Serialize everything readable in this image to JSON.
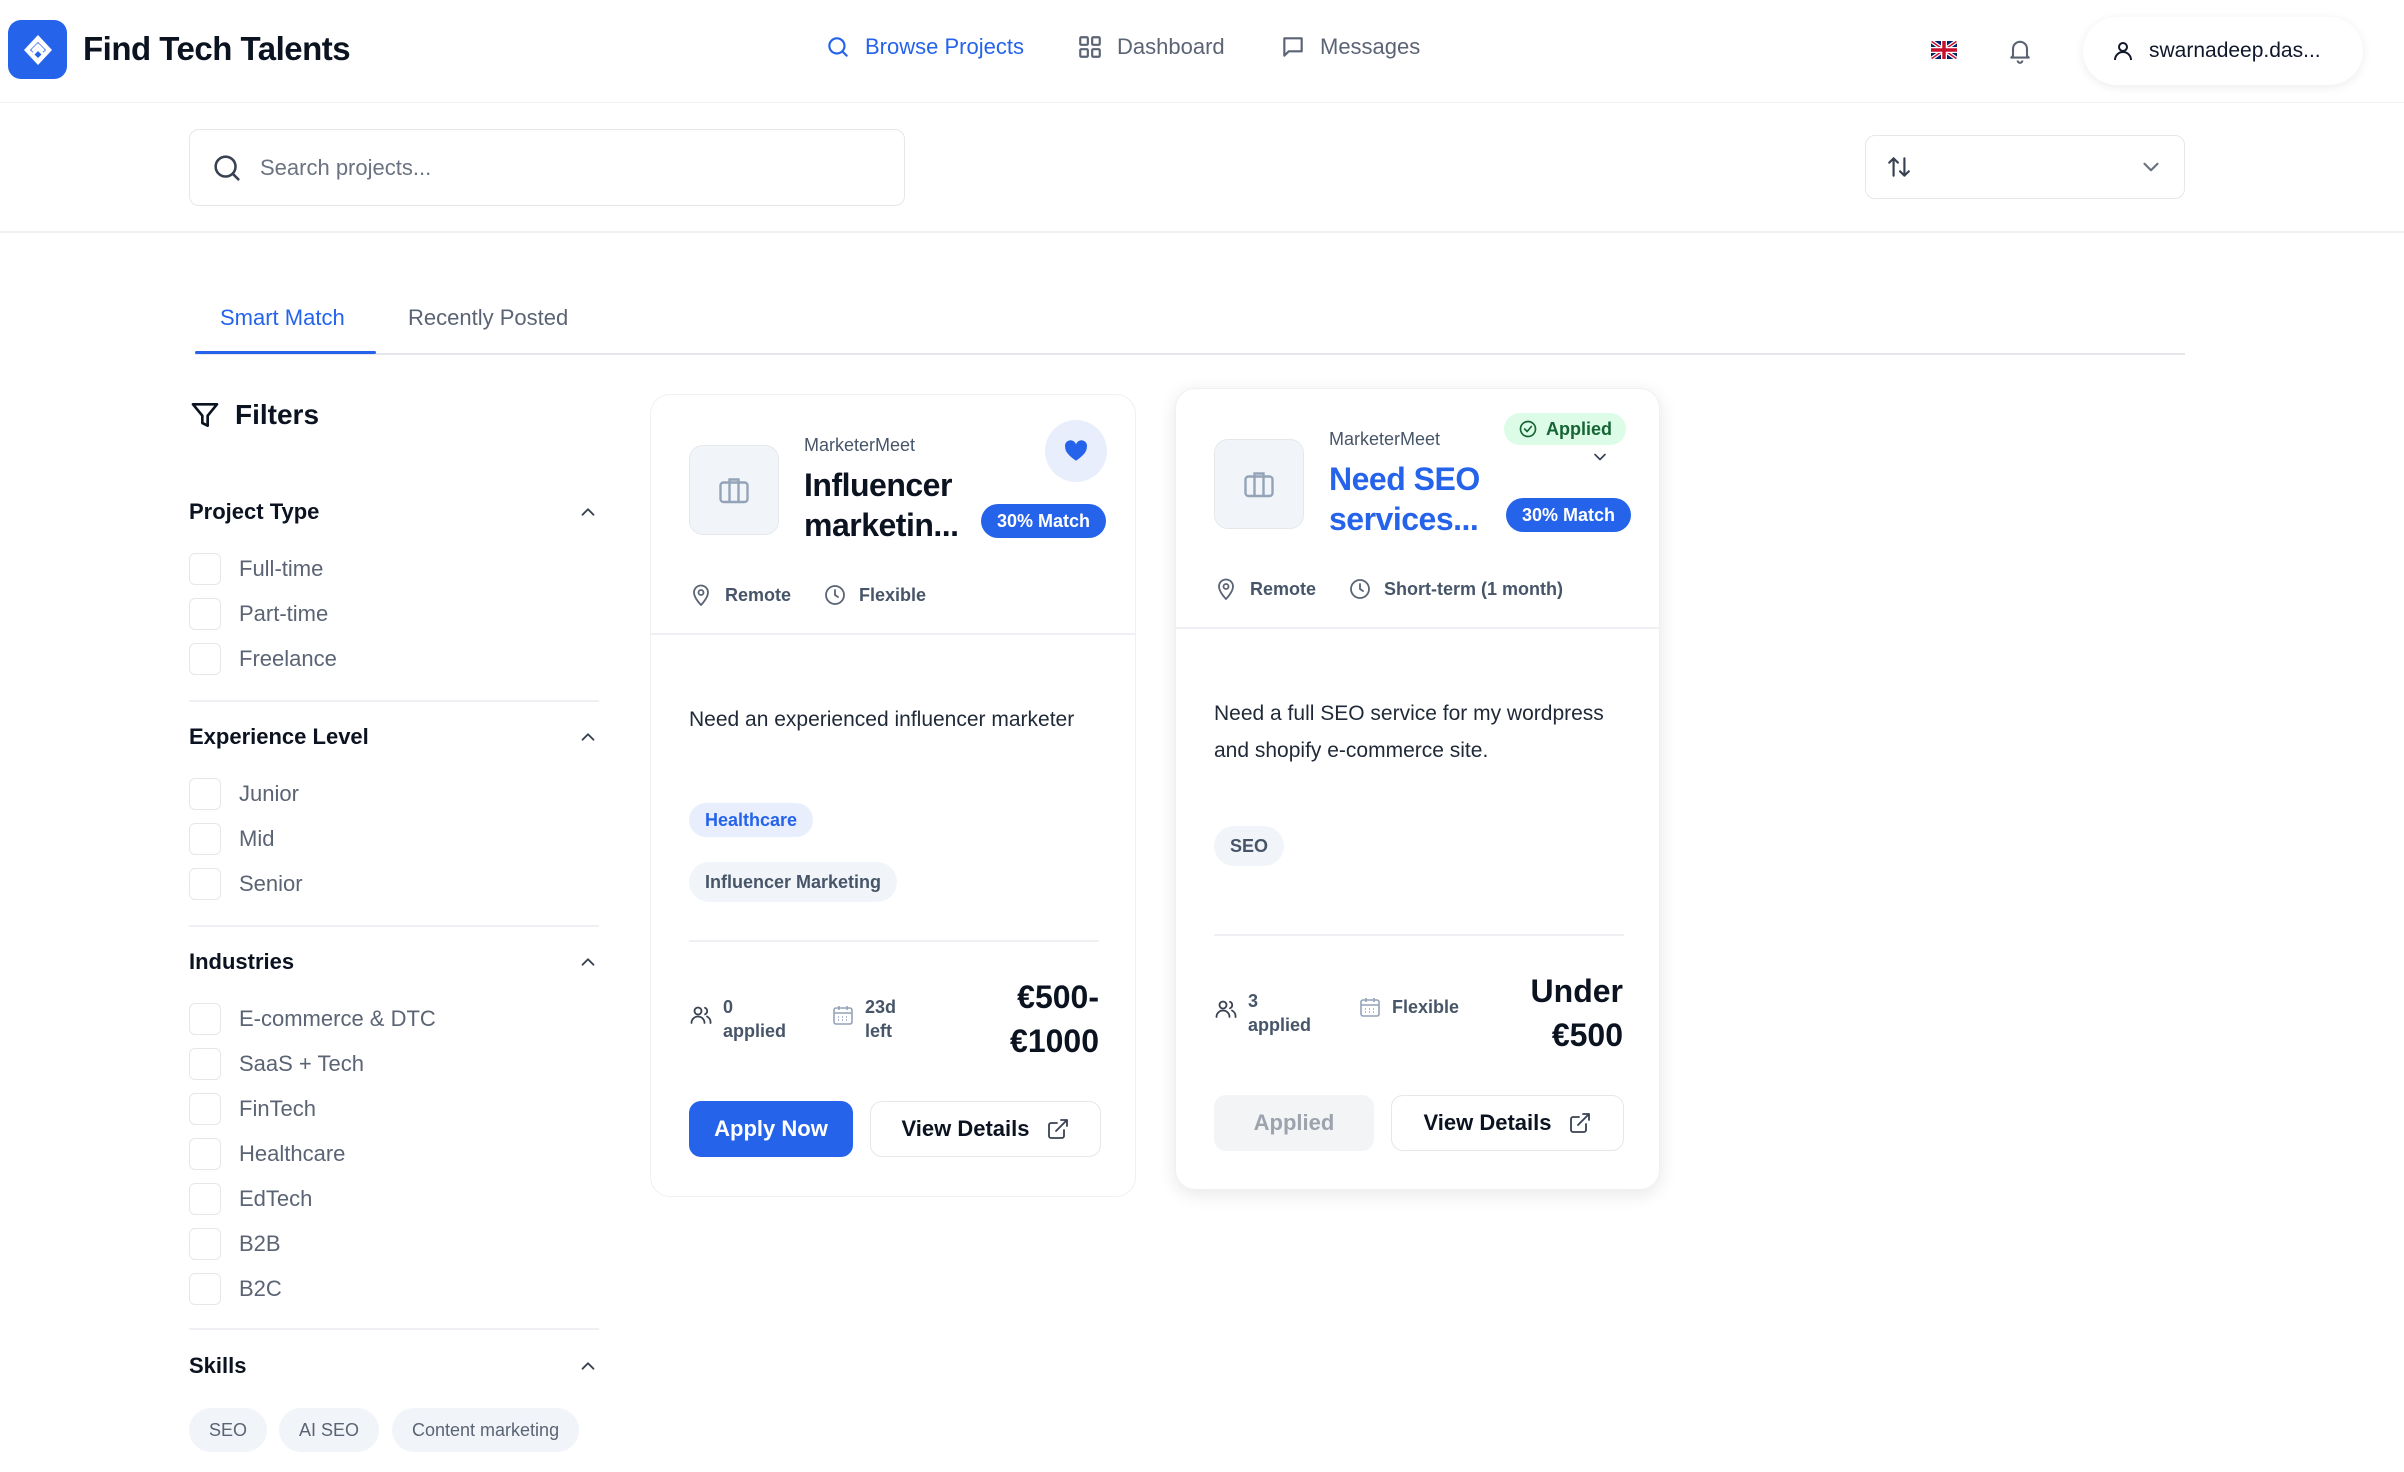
{
  "brand": {
    "name": "Find Tech Talents",
    "accent": "#2563eb"
  },
  "nav": {
    "items": [
      {
        "label": "Browse Projects",
        "icon": "search-icon",
        "active": true
      },
      {
        "label": "Dashboard",
        "icon": "grid-icon",
        "active": false
      },
      {
        "label": "Messages",
        "icon": "chat-icon",
        "active": false
      }
    ],
    "language_flag": "uk-flag-icon",
    "user": "swarnadeep.das..."
  },
  "search": {
    "placeholder": "Search projects...",
    "value": ""
  },
  "sort": {
    "icon": "sort-arrows-icon",
    "value": ""
  },
  "tabs": [
    {
      "label": "Smart Match",
      "active": true
    },
    {
      "label": "Recently Posted",
      "active": false
    }
  ],
  "filters": {
    "title": "Filters",
    "project_type": {
      "title": "Project Type",
      "options": [
        "Full-time",
        "Part-time",
        "Freelance"
      ]
    },
    "experience": {
      "title": "Experience Level",
      "options": [
        "Junior",
        "Mid",
        "Senior"
      ]
    },
    "industries": {
      "title": "Industries",
      "options": [
        "E-commerce & DTC",
        "SaaS + Tech",
        "FinTech",
        "Healthcare",
        "EdTech",
        "B2B",
        "B2C"
      ]
    },
    "skills": {
      "title": "Skills",
      "chips": [
        "SEO",
        "AI SEO",
        "Content marketing"
      ]
    }
  },
  "projects": [
    {
      "company": "MarketerMeet",
      "title": "Influencer marketin...",
      "match": "30% Match",
      "favorited": true,
      "location": "Remote",
      "schedule": "Flexible",
      "description": "Need an experienced influencer marketer",
      "industry_tag": "Healthcare",
      "skill_tags": [
        "Influencer Marketing"
      ],
      "applicants": {
        "count": "0",
        "label": "applied"
      },
      "deadline": {
        "value": "23d",
        "label": "left"
      },
      "price_line1": "€500-",
      "price_line2": "€1000",
      "primary_action": "Apply Now",
      "secondary_action": "View Details"
    },
    {
      "company": "MarketerMeet",
      "title": "Need SEO services...",
      "match": "30% Match",
      "status": "Applied",
      "location": "Remote",
      "schedule": "Short-term (1 month)",
      "description": "Need a full SEO service for my wordpress and shopify e-commerce site.",
      "skill_tags": [
        "SEO"
      ],
      "applicants": {
        "count": "3",
        "label": "applied"
      },
      "deadline_text": "Flexible",
      "price_line1": "Under",
      "price_line2": "€500",
      "primary_action": "Applied",
      "secondary_action": "View Details"
    }
  ]
}
